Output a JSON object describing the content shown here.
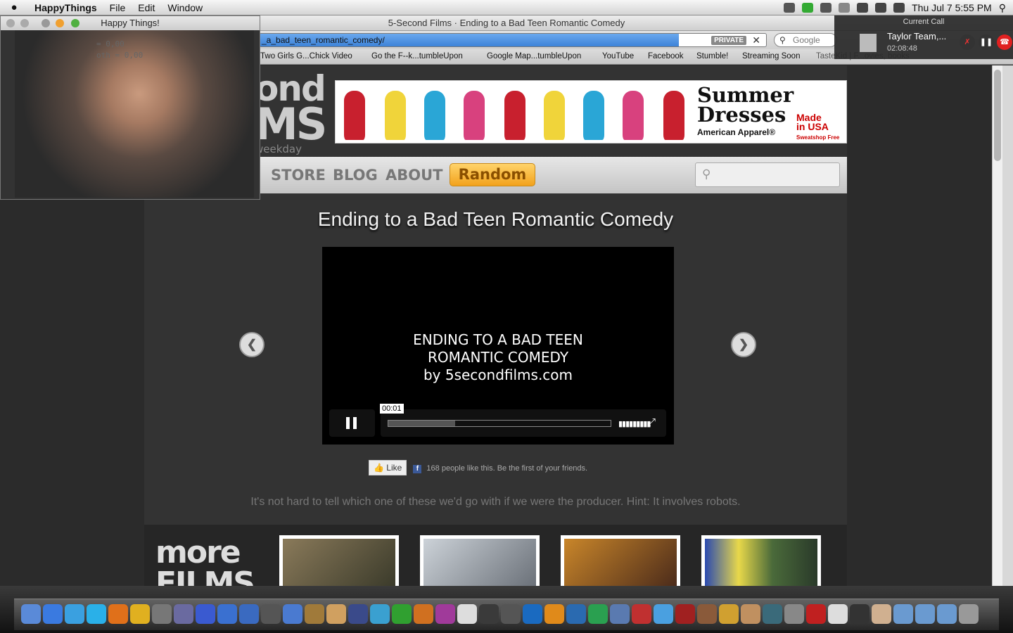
{
  "menubar": {
    "app": "HappyThings",
    "items": [
      "File",
      "Edit",
      "Window"
    ],
    "clock": "Thu Jul 7  5:55 PM"
  },
  "browser": {
    "window_title": "5-Second Films · Ending to a Bad Teen Romantic Comedy",
    "url": "_a_bad_teen_romantic_comedy/",
    "private_badge": "PRIVATE",
    "search_placeholder": "Google",
    "bookmarks": [
      "Two Girls G...Chick Video",
      "Go the F--k...tumbleUpon",
      "Google Map...tumbleUpon",
      "YouTube",
      "Facebook",
      "Stumble!",
      "Streaming Soon",
      "TasteKid | F...ovies, books"
    ]
  },
  "site": {
    "logo_line1": "ond",
    "logo_line2": "MS",
    "logo_tag": "weekday",
    "ad": {
      "headline1": "Summer",
      "headline2": "Dresses",
      "brand": "American Apparel®",
      "badge1": "Made",
      "badge2": "in USA",
      "badge3": "Sweatshop Free",
      "dress_colors": [
        "#c8202e",
        "#f0d43a",
        "#2aa6d6",
        "#d8417e",
        "#c8202e",
        "#f0d43a",
        "#2aa6d6",
        "#d8417e",
        "#c8202e"
      ]
    },
    "nav": {
      "store": "STORE",
      "blog": "BLOG",
      "about": "ABOUT",
      "random": "Random"
    },
    "title": "Ending to a Bad Teen Romantic Comedy",
    "video": {
      "line1": "ENDING TO A BAD TEEN",
      "line2": "ROMANTIC COMEDY",
      "line3": "by 5secondfilms.com",
      "time": "00:01",
      "progress": 0.01,
      "buffered": 0.3
    },
    "like_button": "Like",
    "like_text": "168 people like this. Be the first of your friends.",
    "description": "It's not hard to tell which one of these we'd go with if we were the producer. Hint: It involves robots.",
    "more_line1": "more",
    "more_line2": "FILMS"
  },
  "happy_window": {
    "title": "Happy Things!",
    "line1": "= 0,00",
    "line2": "oth = 0,00"
  },
  "call": {
    "header": "Current Call",
    "name": "Taylor Team,...",
    "duration": "02:08:48"
  },
  "colors": {
    "accent_random": "#f2a21c",
    "hangup": "#e02020"
  }
}
